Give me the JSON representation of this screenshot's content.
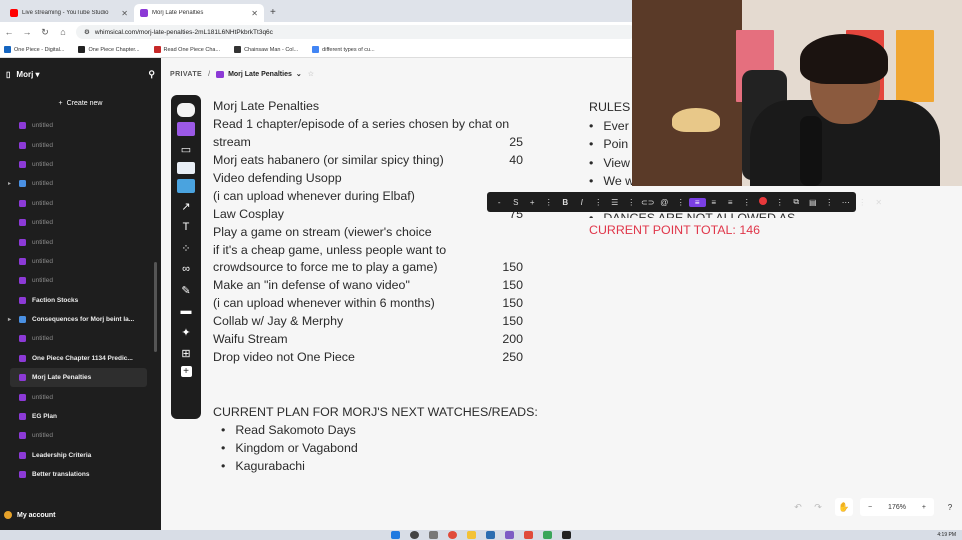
{
  "browser": {
    "tabs": [
      {
        "title": "Live streaming - YouTube Studio",
        "color": "#ff0000"
      },
      {
        "title": "Morj Late Penalties",
        "color": "#8c3ad6"
      }
    ],
    "url": "whimsical.com/morj-late-penalties-2mL181L6NHtPkbrkTt3q6c",
    "bookmarks": [
      {
        "label": "One Piece - Digital...",
        "color": "#1565c0"
      },
      {
        "label": "One Piece Chapter...",
        "color": "#222222"
      },
      {
        "label": "Read One Piece Cha...",
        "color": "#c62828"
      },
      {
        "label": "Chainsaw Man - Col...",
        "color": "#333333"
      },
      {
        "label": "different types of cu...",
        "color": "#4285f4"
      }
    ]
  },
  "sidebar": {
    "workspace": "Morj",
    "create_label": "Create new",
    "items": [
      {
        "label": "untitled",
        "type": "doc",
        "bold": false
      },
      {
        "label": "untitled",
        "type": "doc",
        "bold": false
      },
      {
        "label": "untitled",
        "type": "doc",
        "bold": false
      },
      {
        "label": "untitled",
        "type": "board",
        "bold": false,
        "expandable": true
      },
      {
        "label": "untitled",
        "type": "doc",
        "bold": false
      },
      {
        "label": "untitled",
        "type": "doc",
        "bold": false
      },
      {
        "label": "untitled",
        "type": "doc",
        "bold": false
      },
      {
        "label": "untitled",
        "type": "doc",
        "bold": false
      },
      {
        "label": "untitled",
        "type": "doc",
        "bold": false
      },
      {
        "label": "Faction Stocks",
        "type": "doc",
        "bold": true
      },
      {
        "label": "Consequences for Morj beint la...",
        "type": "board",
        "bold": true,
        "expandable": true
      },
      {
        "label": "untitled",
        "type": "doc",
        "bold": false
      },
      {
        "label": "One Piece Chapter 1134 Predic...",
        "type": "doc",
        "bold": true
      },
      {
        "label": "Morj Late Penalties",
        "type": "doc",
        "bold": true,
        "selected": true
      },
      {
        "label": "untitled",
        "type": "doc",
        "bold": false
      },
      {
        "label": "EG Plan",
        "type": "doc",
        "bold": true
      },
      {
        "label": "untitled",
        "type": "doc",
        "bold": false
      },
      {
        "label": "Leadership Criteria",
        "type": "doc",
        "bold": true
      },
      {
        "label": "Better translations",
        "type": "doc",
        "bold": true
      }
    ],
    "account_label": "My account"
  },
  "topbar": {
    "visibility": "PRIVATE",
    "separator": "/",
    "doc_title": "Morj Late Penalties"
  },
  "penalties": [
    {
      "text": "Morj Late Penalties",
      "value": ""
    },
    {
      "text": "Read 1 chapter/episode of a series chosen by chat on",
      "value": ""
    },
    {
      "text": "stream",
      "value": "25"
    },
    {
      "text": "Morj eats habanero (or similar spicy thing)",
      "value": "40"
    },
    {
      "text": "Video defending Usopp",
      "value": ""
    },
    {
      "text": "(i can upload whenever during Elbaf)",
      "value": ""
    },
    {
      "text": "Law Cosplay",
      "value": "75"
    },
    {
      "text": "Play a game on stream (viewer's choice",
      "value": ""
    },
    {
      "text": "if it's a cheap game, unless people want to",
      "value": ""
    },
    {
      "text": "crowdsource to force me to play a game)",
      "value": "150"
    },
    {
      "text": "Make an \"in defense of wano video\"",
      "value": "150"
    },
    {
      "text": "(i can upload whenever within 6 months)",
      "value": "150"
    },
    {
      "text": "Collab w/ Jay & Merphy",
      "value": "150"
    },
    {
      "text": "Waifu Stream",
      "value": "200"
    },
    {
      "text": "Drop video not One Piece",
      "value": "250"
    }
  ],
  "plan": {
    "heading": "CURRENT PLAN FOR MORJ'S NEXT WATCHES/READS:",
    "items": [
      "Read Sakomoto Days",
      "Kingdom or Vagabond",
      "Kagurabachi"
    ]
  },
  "rules": {
    "heading": "RULES",
    "items": [
      "Ever",
      "Poin",
      "View",
      "We w",
      "",
      "DANCES ARE NOT ALLOWED AS PENALTIES"
    ],
    "point_total": "CURRENT POINT TOTAL: 146"
  },
  "format_toolbar": {
    "font_size": "S",
    "accent": "#7a3fe4"
  },
  "zoom": {
    "level": "176%"
  },
  "taskbar": {
    "clock": "4:19 PM"
  }
}
